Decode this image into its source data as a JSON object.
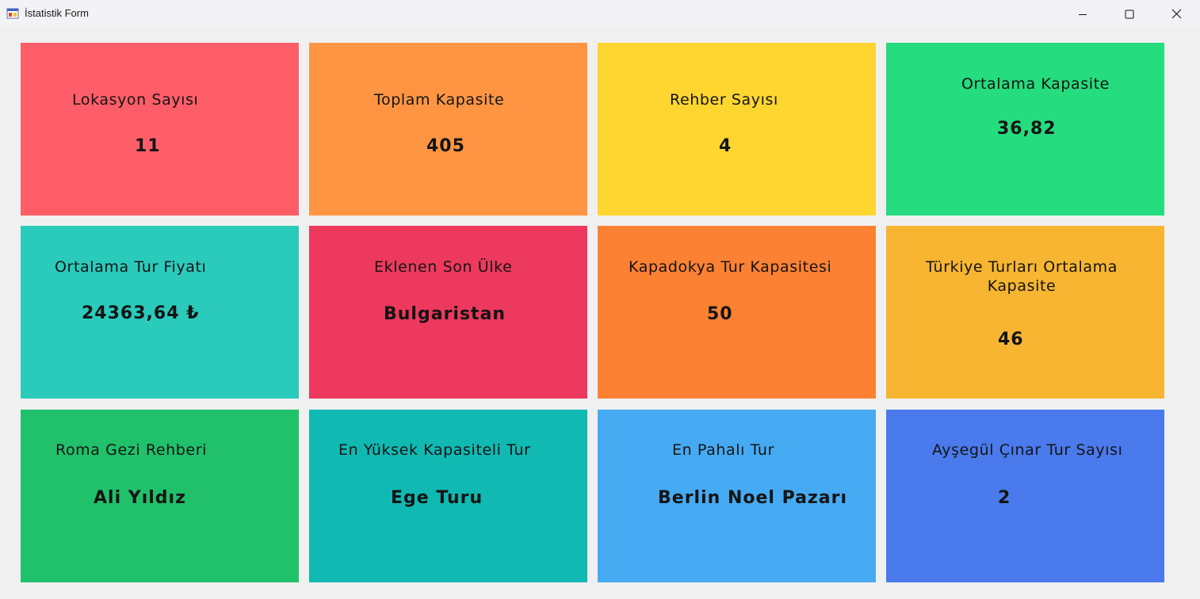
{
  "window": {
    "title": "İstatistik Form",
    "controls": {
      "minimize_icon": "minimize-icon",
      "maximize_icon": "maximize-icon",
      "close_icon": "close-icon"
    }
  },
  "tiles": [
    {
      "label": "Lokasyon Sayısı",
      "value": "11",
      "color": "#ff5e68"
    },
    {
      "label": "Toplam Kapasite",
      "value": "405",
      "color": "#ff9543"
    },
    {
      "label": "Rehber Sayısı",
      "value": "4",
      "color": "#ffd530"
    },
    {
      "label": "Ortalama Kapasite",
      "value": "36,82",
      "color": "#25dc7e"
    },
    {
      "label": "Ortalama Tur Fiyatı",
      "value": "24363,64 ₺",
      "color": "#2acbbb"
    },
    {
      "label": "Eklenen Son Ülke",
      "value": "Bulgaristan",
      "color": "#ec395d"
    },
    {
      "label": "Kapadokya Tur Kapasitesi",
      "value": "50",
      "color": "#fd8133"
    },
    {
      "label": "Türkiye Turları Ortalama Kapasite",
      "value": "46",
      "color": "#f7b531"
    },
    {
      "label": "Roma Gezi Rehberi",
      "value": "Ali Yıldız",
      "color": "#21c06a"
    },
    {
      "label": "En Yüksek Kapasiteli Tur",
      "value": "Ege Turu",
      "color": "#10b9b2"
    },
    {
      "label": "En Pahalı Tur",
      "value": "Berlin Noel Pazarı",
      "color": "#46aaf3"
    },
    {
      "label": "Ayşegül Çınar Tur Sayısı",
      "value": "2",
      "color": "#4a7aec"
    }
  ]
}
